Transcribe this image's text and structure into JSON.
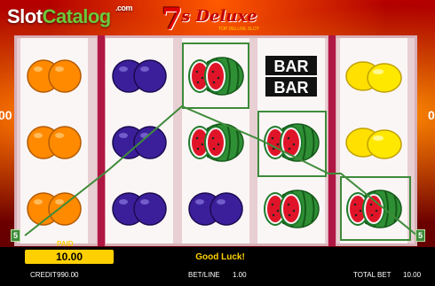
{
  "watermark": {
    "part1": "Slot",
    "part2": "Catalog",
    "suffix": ".com"
  },
  "logo": {
    "seven": "7",
    "deluxe": "s Deluxe",
    "subtitle": "TOP DELUXE SLOT"
  },
  "side_numbers": {
    "left": "00",
    "right": "0"
  },
  "colors": {
    "win_line": "#3e8b3a",
    "paid_box": "#ffd000",
    "message": "#ffd200",
    "frame_divider": "#b01844"
  },
  "reels": [
    [
      "orange",
      "orange",
      "orange"
    ],
    [
      "plum",
      "plum",
      "plum"
    ],
    [
      "watermelon",
      "watermelon",
      "plum"
    ],
    [
      "bar-bar",
      "watermelon",
      "watermelon"
    ],
    [
      "lemon",
      "lemon",
      "watermelon"
    ]
  ],
  "payline": {
    "number_left": "5",
    "number_right": "5"
  },
  "win": {
    "paid_label": "PAID",
    "paid_value": "10.00",
    "message": "Good Luck!"
  },
  "footer": {
    "credit_label": "CREDIT",
    "credit_value": "990.00",
    "betline_label": "BET/LINE",
    "betline_value": "1.00",
    "totalbet_label": "TOTAL BET",
    "totalbet_value": "10.00"
  }
}
